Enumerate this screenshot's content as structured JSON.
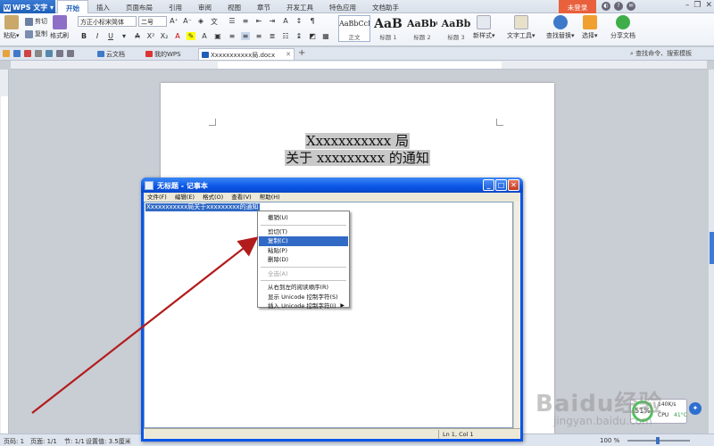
{
  "app": {
    "name": "WPS 文字",
    "ribbon_tabs": [
      "开始",
      "插入",
      "页面布局",
      "引用",
      "审阅",
      "视图",
      "章节",
      "开发工具",
      "特色应用",
      "文档助手"
    ],
    "login": "未登录"
  },
  "toolbar": {
    "cut": "剪切",
    "copy": "复制",
    "format_painter": "格式刷",
    "paste": "粘贴",
    "font": "方正小标宋简体",
    "size": "二号",
    "styles": [
      {
        "sample": "AaBbCcD",
        "label": "正文"
      },
      {
        "sample": "AaB",
        "label": "标题 1"
      },
      {
        "sample": "AaBbC",
        "label": "标题 2"
      },
      {
        "sample": "AaBb",
        "label": "标题 3"
      }
    ],
    "new_style": "新样式",
    "text_tools": "文字工具",
    "find_replace": "查找替换",
    "select": "选择",
    "share": "分享文档"
  },
  "tabs": {
    "docs": [
      "云文档",
      "我的WPS",
      "Xxxxxxxxxxx局.docx"
    ],
    "search": "查找命令、搜索模板"
  },
  "document": {
    "line1": "Xxxxxxxxxxx 局",
    "line2": "关于 xxxxxxxxx 的通知"
  },
  "notepad": {
    "title": "无标题 - 记事本",
    "menu": [
      "文件(F)",
      "编辑(E)",
      "格式(O)",
      "查看(V)",
      "帮助(H)"
    ],
    "selected_text": "Xxxxxxxxxxx局关于xxxxxxxxx的通知",
    "status": "Ln 1, Col 1"
  },
  "context_menu": {
    "undo": "撤销(U)",
    "cut": "剪切(T)",
    "copy": "复制(C)",
    "paste": "粘贴(P)",
    "delete": "删除(D)",
    "select_all": "全选(A)",
    "rtl": "从右到左的阅读顺序(R)",
    "show_unicode": "显示 Unicode 控制字符(S)",
    "insert_unicode": "插入 Unicode 控制字符(I)"
  },
  "statusbar": {
    "page_num": "页码: 1",
    "pages": "页面: 1/1",
    "section": "节: 1/1",
    "setting": "设置值: 3.5厘米",
    "zoom": "100 %"
  },
  "monitor": {
    "percent": "51%",
    "speed": "140K/s",
    "cpu": "CPU",
    "temp": "41°C"
  },
  "watermark": {
    "brand": "Baidu经验",
    "url": "jingyan.baidu.com"
  },
  "colors": {
    "app_blue": "#1f5fb8",
    "login_orange": "#e8603c",
    "xp_title_blue": "#0a56e8",
    "selection": "#316ac5",
    "arrow": "#b21c1c"
  }
}
